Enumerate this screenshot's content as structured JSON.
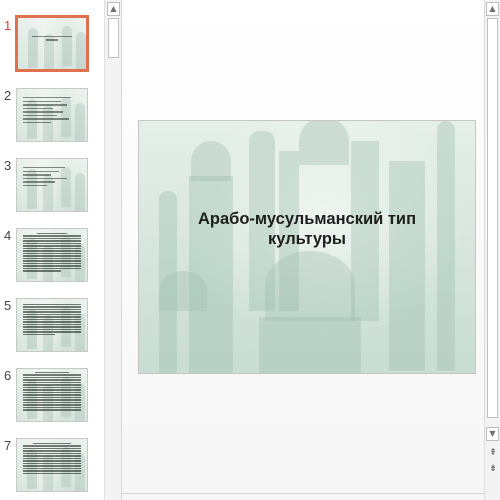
{
  "slides": [
    {
      "number": "1",
      "active": true,
      "kind": "title"
    },
    {
      "number": "2",
      "active": false,
      "kind": "list"
    },
    {
      "number": "3",
      "active": false,
      "kind": "list"
    },
    {
      "number": "4",
      "active": false,
      "kind": "dense"
    },
    {
      "number": "5",
      "active": false,
      "kind": "dense"
    },
    {
      "number": "6",
      "active": false,
      "kind": "dense"
    },
    {
      "number": "7",
      "active": false,
      "kind": "dense"
    }
  ],
  "current_slide": {
    "title_line1": "Арабо-мусульманский тип",
    "title_line2": "культуры"
  },
  "icons": {
    "scroll_up": "scroll-up-arrow-icon",
    "scroll_down": "scroll-down-arrow-icon",
    "previous_slide": "previous-slide-icon",
    "next_slide": "next-slide-icon"
  },
  "colors": {
    "active_slide_border": "#e0714f",
    "active_slide_number": "#d24726",
    "slide_background": "#d7e6de"
  }
}
